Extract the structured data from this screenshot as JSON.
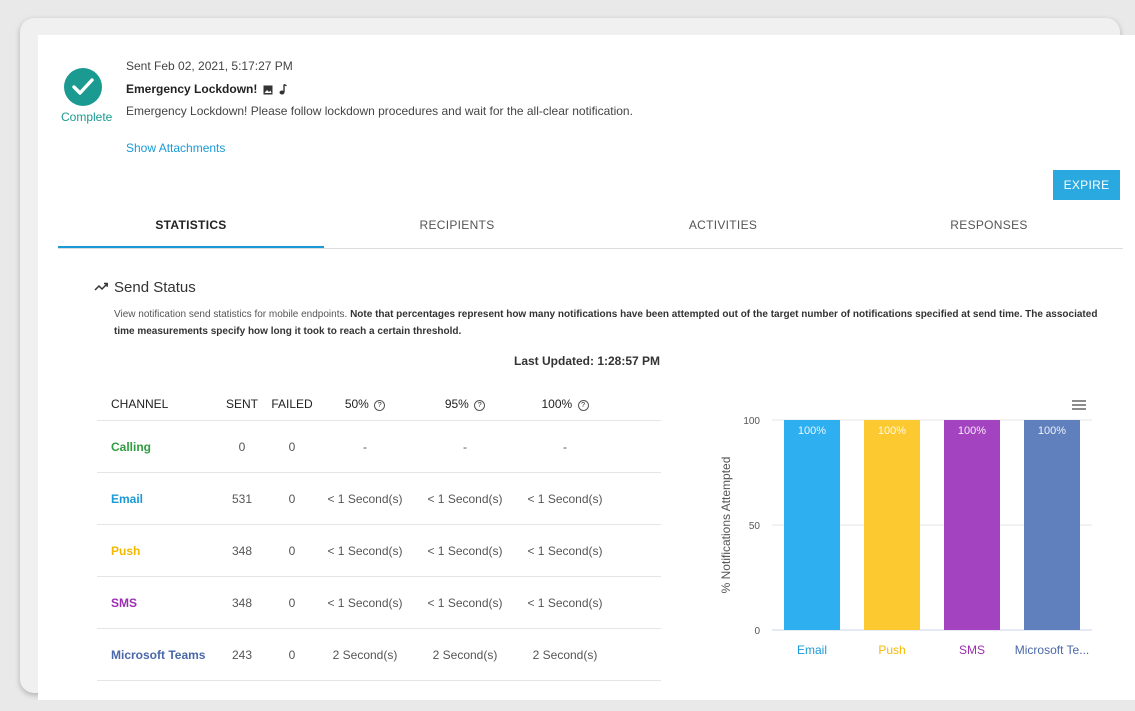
{
  "header": {
    "status": "Complete",
    "sent": "Sent Feb 02, 2021, 5:17:27 PM",
    "title": "Emergency Lockdown!",
    "message": "Emergency Lockdown! Please follow lockdown procedures and wait for the all-clear notification.",
    "show_attachments": "Show Attachments",
    "expire": "EXPIRE"
  },
  "tabs": [
    {
      "label": "STATISTICS",
      "active": true
    },
    {
      "label": "RECIPIENTS",
      "active": false
    },
    {
      "label": "ACTIVITIES",
      "active": false
    },
    {
      "label": "RESPONSES",
      "active": false
    }
  ],
  "section": {
    "title": "Send Status",
    "desc_plain": "View notification send statistics for mobile endpoints. ",
    "desc_bold": "Note that percentages represent how many notifications have been attempted out of the target number of notifications specified at send time. The associated time measurements specify how long it took to reach a certain threshold.",
    "updated": "Last Updated: 1:28:57 PM"
  },
  "table": {
    "headers": [
      "CHANNEL",
      "SENT",
      "FAILED",
      "50%",
      "95%",
      "100%"
    ],
    "rows": [
      {
        "channel": "Calling",
        "color": "#2e9e3e",
        "sent": "0",
        "failed": "0",
        "p50": "-",
        "p95": "-",
        "p100": "-"
      },
      {
        "channel": "Email",
        "color": "#1a9ad6",
        "sent": "531",
        "failed": "0",
        "p50": "< 1 Second(s)",
        "p95": "< 1 Second(s)",
        "p100": "< 1 Second(s)"
      },
      {
        "channel": "Push",
        "color": "#f5b800",
        "sent": "348",
        "failed": "0",
        "p50": "< 1 Second(s)",
        "p95": "< 1 Second(s)",
        "p100": "< 1 Second(s)"
      },
      {
        "channel": "SMS",
        "color": "#9b2fb0",
        "sent": "348",
        "failed": "0",
        "p50": "< 1 Second(s)",
        "p95": "< 1 Second(s)",
        "p100": "< 1 Second(s)"
      },
      {
        "channel": "Microsoft Teams",
        "color": "#4a67a8",
        "sent": "243",
        "failed": "0",
        "p50": "2 Second(s)",
        "p95": "2 Second(s)",
        "p100": "2 Second(s)"
      }
    ]
  },
  "chart_data": {
    "type": "bar",
    "categories": [
      "Email",
      "Push",
      "SMS",
      "Microsoft Te..."
    ],
    "values": [
      100,
      100,
      100,
      100
    ],
    "data_labels": [
      "100%",
      "100%",
      "100%",
      "100%"
    ],
    "colors": [
      "#2eaff0",
      "#fcca30",
      "#a343bf",
      "#5f80bd"
    ],
    "category_label_colors": [
      "#1a9ad6",
      "#f5b800",
      "#9b2fb0",
      "#4a67a8"
    ],
    "xlabel": "",
    "ylabel": "% Notifications Attempted",
    "ylim": [
      0,
      100
    ],
    "yticks": [
      "0",
      "50",
      "100"
    ],
    "grid": true
  }
}
